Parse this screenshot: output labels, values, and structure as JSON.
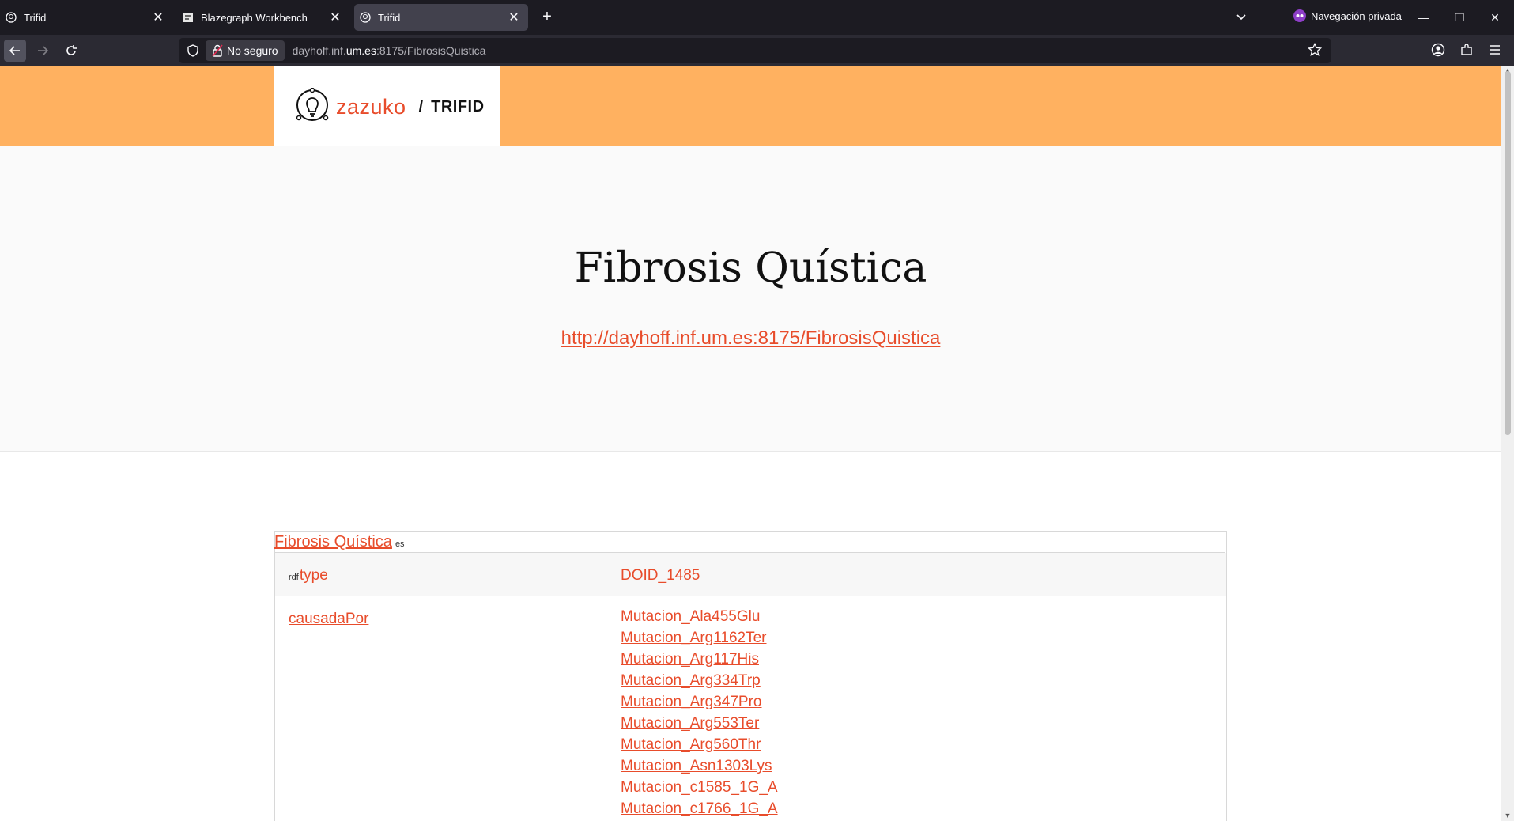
{
  "browser": {
    "tabs": [
      {
        "title": "Trifid",
        "active": false
      },
      {
        "title": "Blazegraph Workbench",
        "active": false
      },
      {
        "title": "Trifid",
        "active": true
      }
    ],
    "private_label": "Navegación privada",
    "security_label": "No seguro",
    "url_prefix": "dayhoff.inf.",
    "url_domain": "um.es",
    "url_suffix": ":8175/FibrosisQuistica"
  },
  "site": {
    "brand": "zazuko",
    "separator": "/",
    "product": "TRIFID"
  },
  "resource": {
    "title": "Fibrosis Quística",
    "iri": "http://dayhoff.inf.um.es:8175/FibrosisQuistica",
    "label": "Fibrosis Quística",
    "label_lang": "es",
    "rows": [
      {
        "prefix": "rdf",
        "predicate": "type",
        "objects": [
          "DOID_1485"
        ]
      },
      {
        "prefix": "",
        "predicate": "causadaPor",
        "objects": [
          "Mutacion_Ala455Glu",
          "Mutacion_Arg1162Ter",
          "Mutacion_Arg117His",
          "Mutacion_Arg334Trp",
          "Mutacion_Arg347Pro",
          "Mutacion_Arg553Ter",
          "Mutacion_Arg560Thr",
          "Mutacion_Asn1303Lys",
          "Mutacion_c1585_1G_A",
          "Mutacion_c1766_1G_A"
        ]
      }
    ]
  },
  "colors": {
    "header_orange": "#ffb160",
    "link_red": "#e84c2b",
    "chrome_dark": "#1c1b22"
  }
}
